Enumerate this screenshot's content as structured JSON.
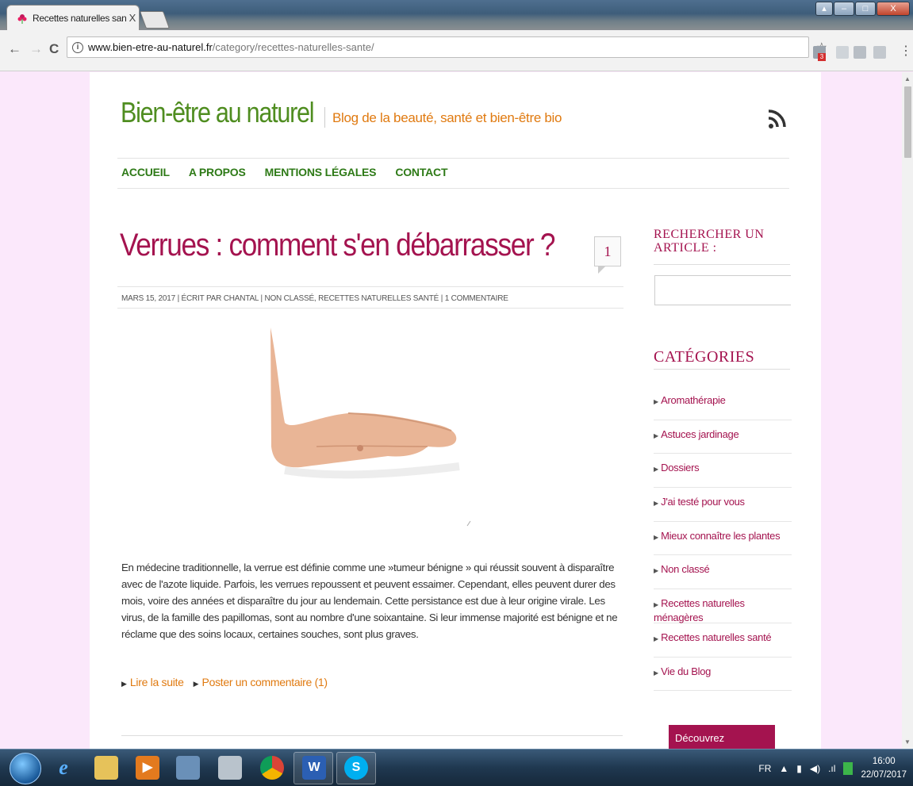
{
  "browser": {
    "tab_title": "Recettes naturelles santé",
    "tab_close": "X",
    "url_host": "www.bien-etre-au-naturel.fr",
    "url_path": "/category/recettes-naturelles-sante/",
    "back": "←",
    "forward": "→",
    "reload": "C",
    "info": "i",
    "star": "☆",
    "menu": "⋮",
    "ext_badge": "3",
    "win_min": "–",
    "win_max": "□",
    "win_close": "X"
  },
  "site": {
    "title": "Bien-être au naturel",
    "tagline": "Blog de la beauté, santé et bien-être bio"
  },
  "nav": {
    "items": [
      "ACCUEIL",
      "A PROPOS",
      "MENTIONS LÉGALES",
      "CONTACT"
    ]
  },
  "post": {
    "title": "Verrues : comment s'en débarrasser ?",
    "comment_count": "1",
    "meta": "MARS 15, 2017 | ÉCRIT PAR CHANTAL  |  NON CLASSÉ, RECETTES NATURELLES SANTÉ  |  1 COMMENTAIRE",
    "excerpt": "En médecine traditionnelle, la verrue est définie comme une  »tumeur bénigne » qui réussit souvent à disparaître avec de l'azote liquide. Parfois, les verrues repoussent et peuvent essaimer. Cependant, elles peuvent durer des mois, voire des années et disparaître du jour au lendemain. Cette persistance est due à leur origine virale. Les virus, de la famille des papillomas, sont au nombre d'une soixantaine. Si leur immense majorité est bénigne et ne réclame que des soins locaux, certaines souches, sont plus graves.",
    "read_more": "Lire la suite",
    "post_comment": "Poster un commentaire (1)"
  },
  "sidebar": {
    "search_heading": "RECHERCHER UN ARTICLE :",
    "categories_heading": "CATÉGORIES",
    "categories": [
      "Aromathérapie",
      "Astuces jardinage",
      "Dossiers",
      "J'ai testé pour vous",
      "Mieux connaître les plantes",
      "Non classé",
      "Recettes naturelles ménagères",
      "Recettes naturelles santé",
      "Vie du Blog"
    ],
    "discover": "Découvrez"
  },
  "taskbar": {
    "lang": "FR",
    "time": "16:00",
    "date": "22/07/2017"
  },
  "colors": {
    "brand_green": "#4f8d20",
    "accent_orange": "#e07a10",
    "accent_magenta": "#a4134f",
    "page_bg": "#fbe8fb"
  }
}
